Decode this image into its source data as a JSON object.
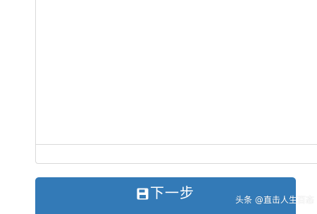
{
  "form": {
    "textarea_value": "",
    "next_button_label": "下一步",
    "next_button_icon": "save-icon"
  },
  "watermark": {
    "text": "头条 @直击人生百态"
  },
  "colors": {
    "button_bg": "#337ab7",
    "button_text": "#ffffff",
    "border": "#d9d9d9"
  }
}
